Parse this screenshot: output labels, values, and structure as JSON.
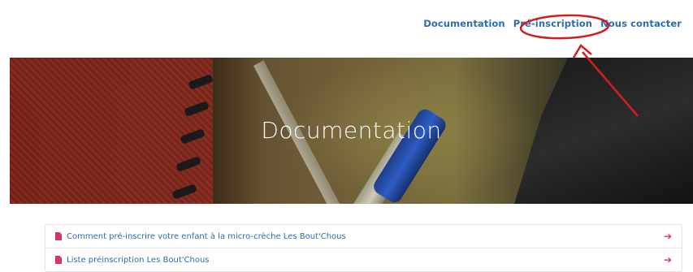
{
  "nav": {
    "items": [
      {
        "label": "Documentation"
      },
      {
        "label": "Pré-inscription"
      },
      {
        "label": "Nous contacter"
      }
    ]
  },
  "hero": {
    "title": "Documentation"
  },
  "docs": {
    "items": [
      {
        "label": "Comment pré-inscrire votre enfant à la micro-crèche Les Bout'Chous",
        "icon": "document-icon",
        "arrow_icon": "arrow-right-icon"
      },
      {
        "label": "Liste préinscription Les Bout'Chous",
        "icon": "document-icon",
        "arrow_icon": "arrow-right-icon"
      }
    ]
  },
  "colors": {
    "link": "#2a6db0",
    "accent": "#d6336c",
    "annotation": "#d11f1f"
  }
}
